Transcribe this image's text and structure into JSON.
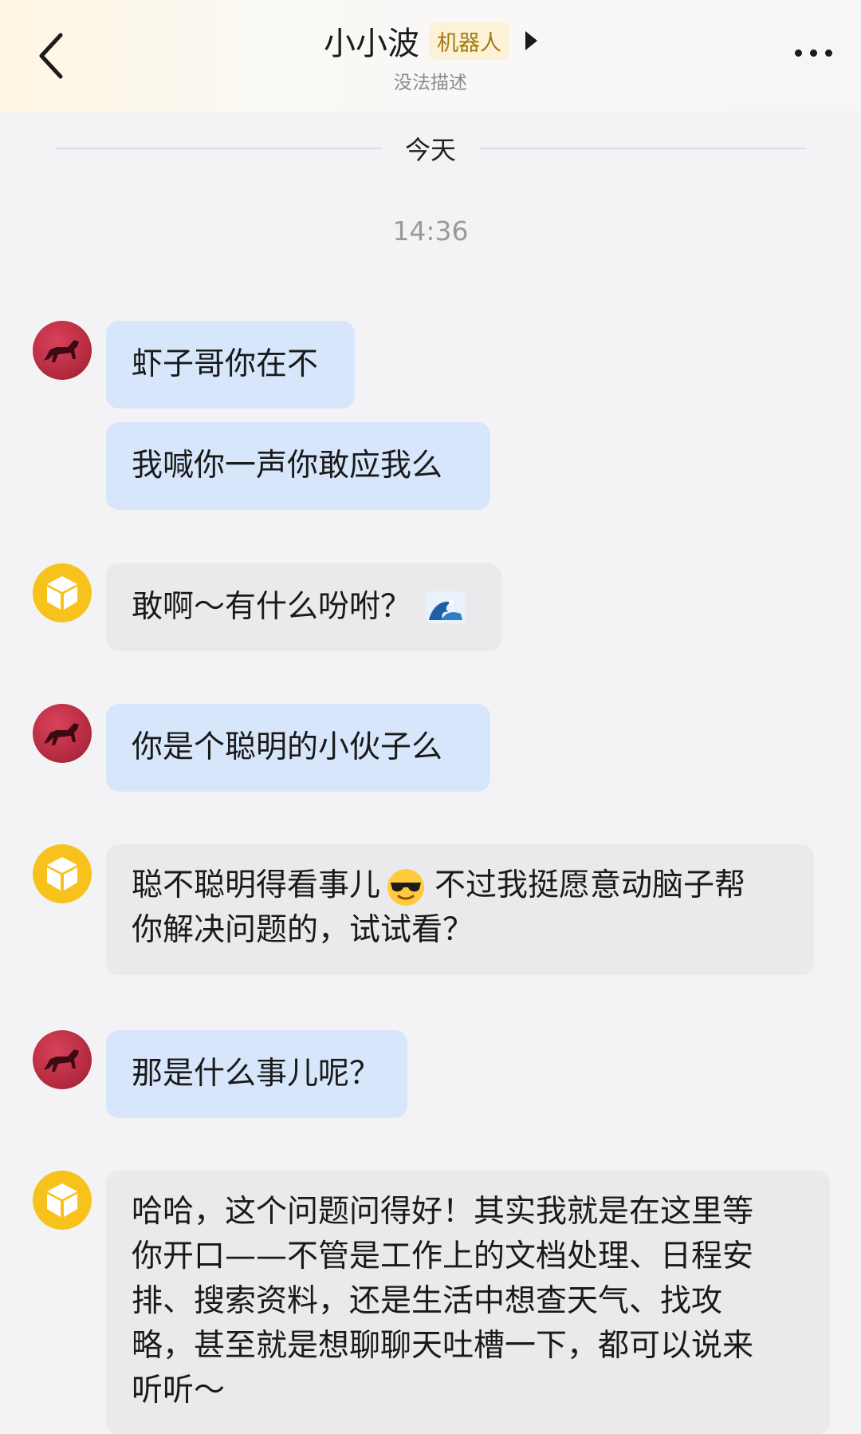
{
  "header": {
    "title": "小小波",
    "badge": "机器人",
    "subtitle": "没法描述",
    "back_icon": "chevron-left-icon",
    "more_icon": "more-horizontal-icon"
  },
  "divider": {
    "date": "今天"
  },
  "timestamp": "14:36",
  "messages": [
    {
      "sender": "user",
      "text": "虾子哥你在不"
    },
    {
      "sender": "user",
      "text": "我喊你一声你敢应我么"
    },
    {
      "sender": "bot",
      "text": "敢啊～有什么吩咐？",
      "emoji": "wave-emoji"
    },
    {
      "sender": "user",
      "text": "你是个聪明的小伙子么"
    },
    {
      "sender": "bot",
      "text_a": "聪不聪明得看事儿",
      "emoji": "sunglasses-emoji",
      "text_b": "不过我挺愿意动脑子帮",
      "text_c": "你解决问题的，试试看？"
    },
    {
      "sender": "user",
      "text": "那是什么事儿呢？"
    },
    {
      "sender": "bot",
      "lines": [
        "哈哈，这个问题问得好！其实我就是在这里等",
        "你开口——不管是工作上的文档处理、日程安",
        "排、搜索资料，还是生活中想查天气、找攻",
        "略，甚至就是想聊聊天吐槽一下，都可以说来",
        "听听～"
      ]
    }
  ],
  "colors": {
    "user_bubble": "#d8e6fb",
    "bot_bubble": "#eaeaed",
    "bot_avatar": "#f7c21c",
    "user_avatar": "#b42a3e",
    "badge_text": "#a37a14"
  }
}
